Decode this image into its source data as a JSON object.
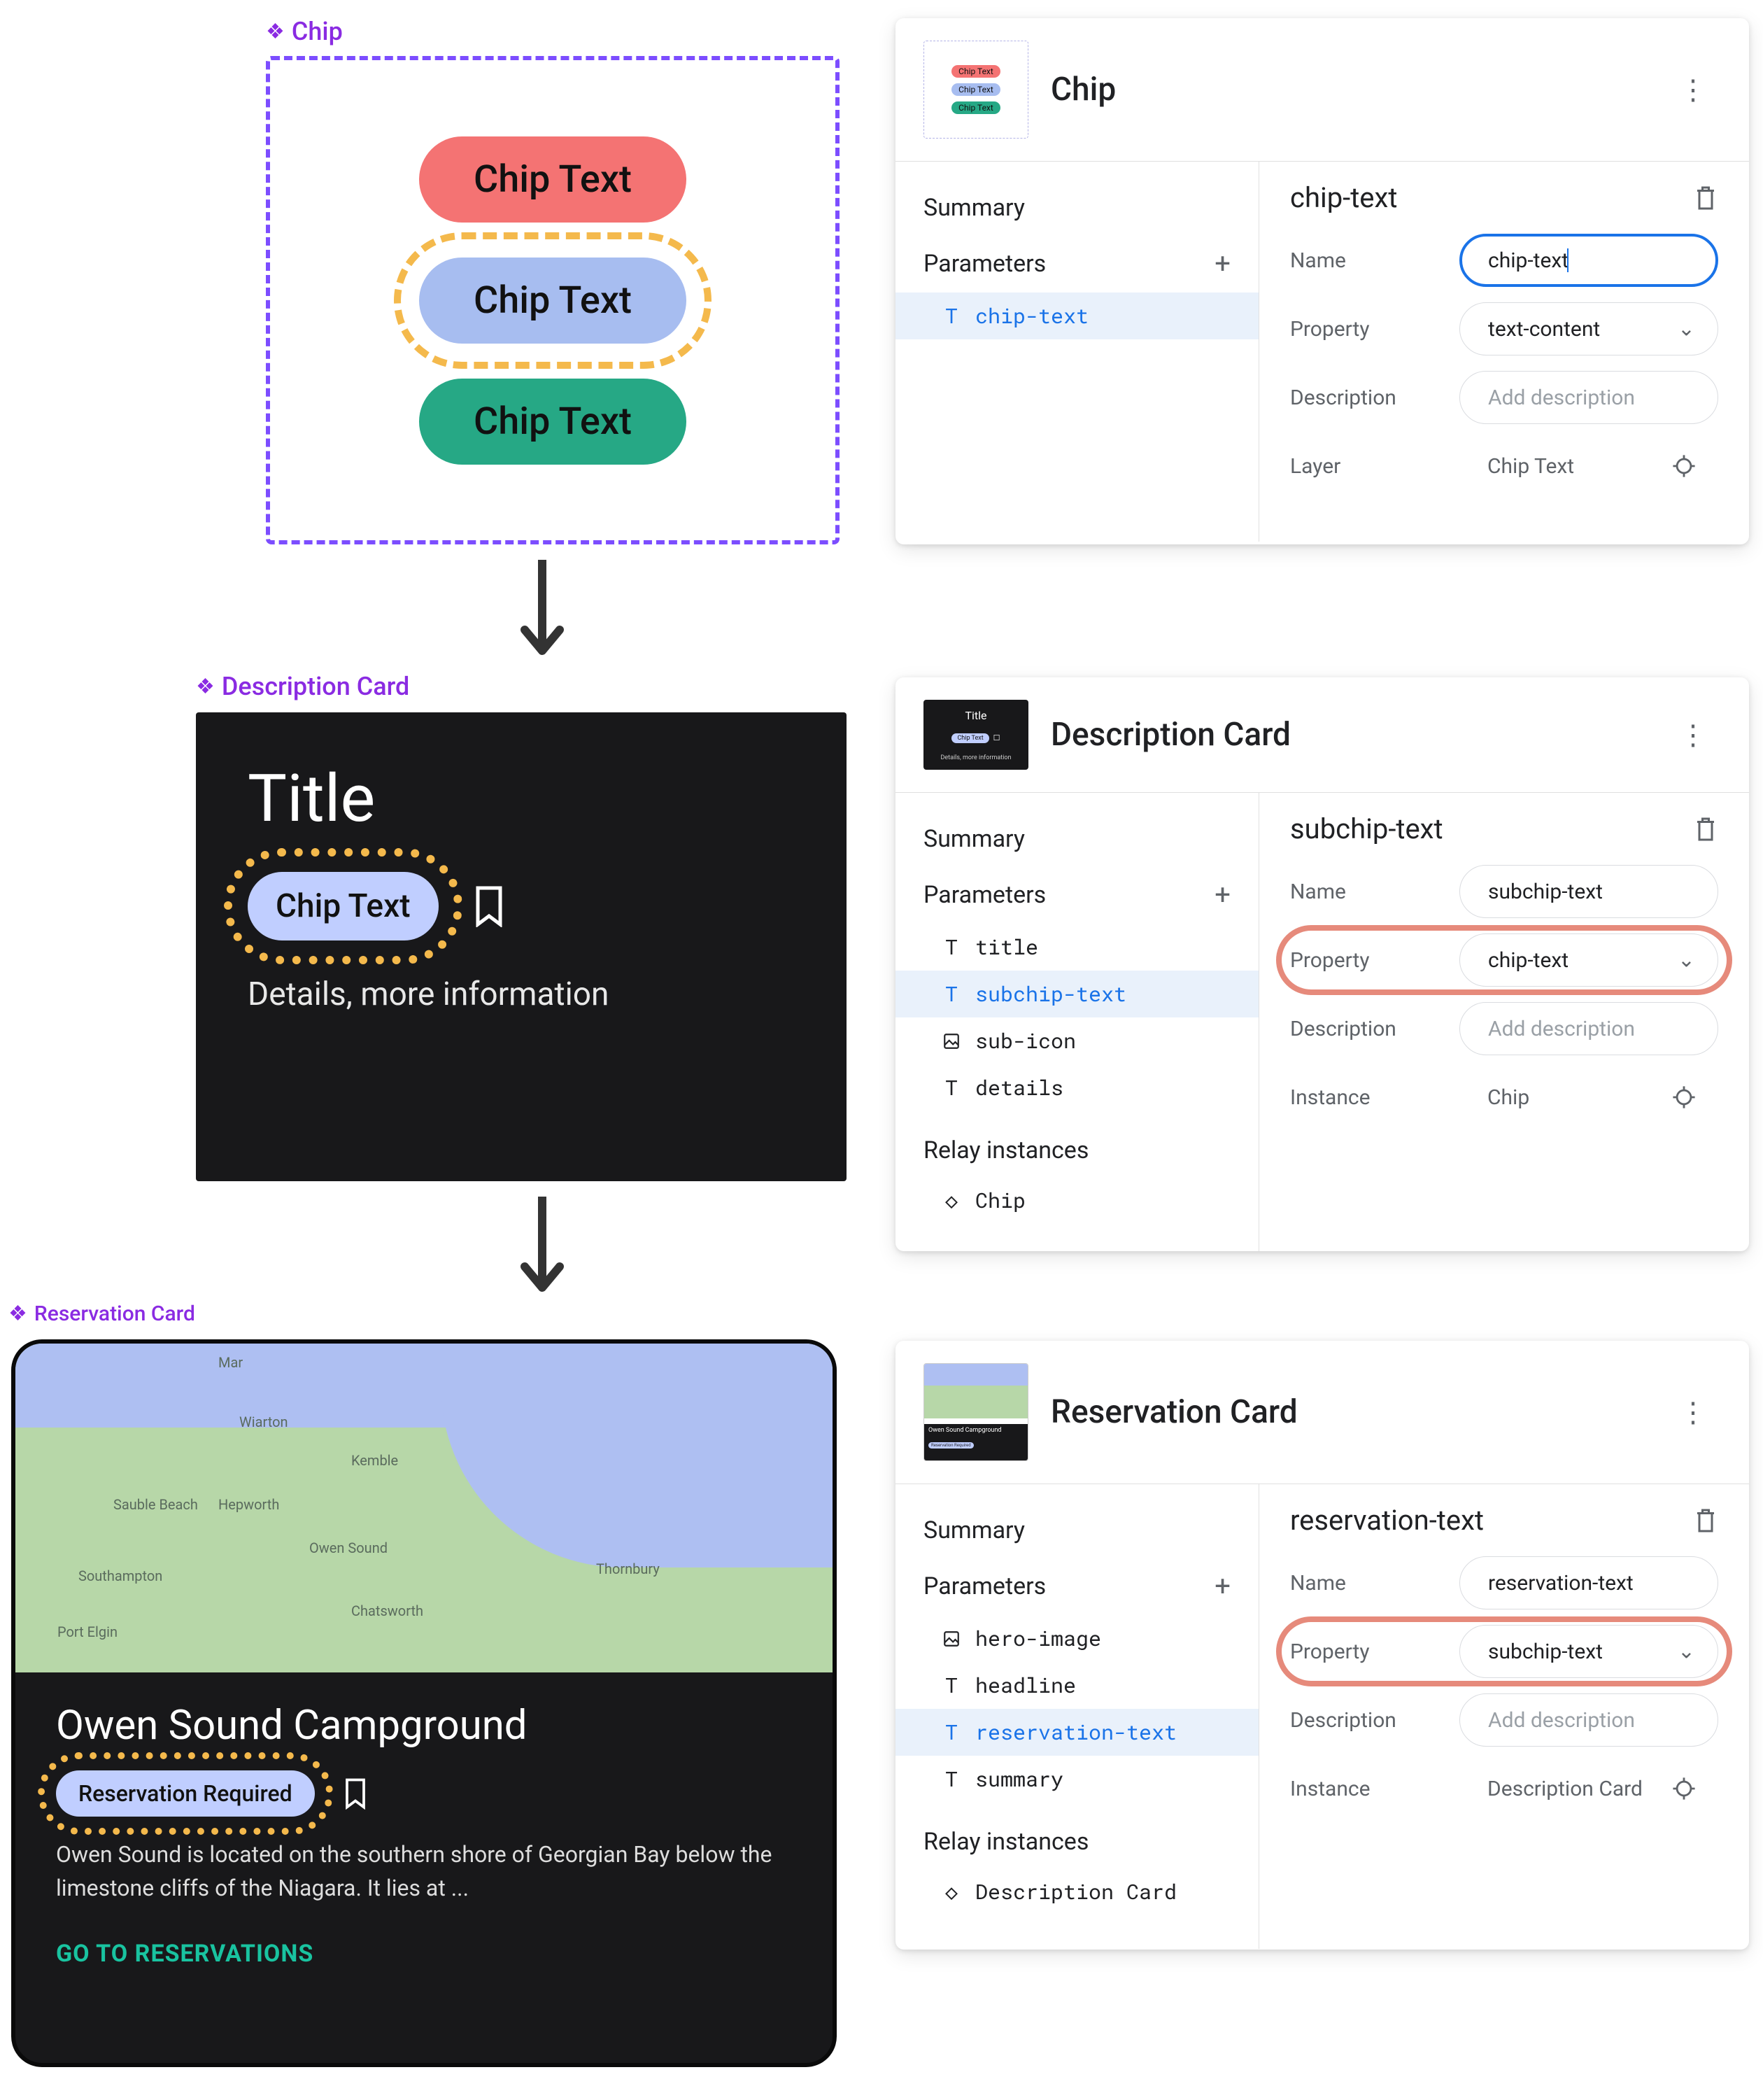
{
  "components": {
    "chip": {
      "label": "Chip",
      "variants": [
        "Chip Text",
        "Chip Text",
        "Chip Text"
      ]
    },
    "description_card": {
      "label": "Description Card",
      "title": "Title",
      "chip_text": "Chip Text",
      "details": "Details, more information"
    },
    "reservation_card": {
      "label": "Reservation Card",
      "headline": "Owen Sound Campground",
      "chip_text": "Reservation Required",
      "summary": "Owen Sound is located on the southern shore of Georgian Bay below the limestone cliffs of the Niagara. It lies at ...",
      "cta": "GO TO RESERVATIONS",
      "map_labels": [
        "Mar",
        "Wiarton",
        "Kemble",
        "Sauble Beach",
        "Hepworth",
        "Owen Sound",
        "Southampton",
        "Chatsworth",
        "Thornbury",
        "Port Elgin"
      ]
    }
  },
  "panels": {
    "chip": {
      "title": "Chip",
      "summary_label": "Summary",
      "parameters_label": "Parameters",
      "params": [
        "chip-text"
      ],
      "form": {
        "title": "chip-text",
        "name_label": "Name",
        "name_value": "chip-text",
        "property_label": "Property",
        "property_value": "text-content",
        "description_label": "Description",
        "description_placeholder": "Add description",
        "layer_label": "Layer",
        "layer_value": "Chip Text"
      }
    },
    "desc": {
      "title": "Description Card",
      "summary_label": "Summary",
      "parameters_label": "Parameters",
      "params": [
        "title",
        "subchip-text",
        "sub-icon",
        "details"
      ],
      "relay_label": "Relay instances",
      "relay_items": [
        "Chip"
      ],
      "form": {
        "title": "subchip-text",
        "name_label": "Name",
        "name_value": "subchip-text",
        "property_label": "Property",
        "property_value": "chip-text",
        "description_label": "Description",
        "description_placeholder": "Add description",
        "instance_label": "Instance",
        "instance_value": "Chip"
      }
    },
    "res": {
      "title": "Reservation Card",
      "summary_label": "Summary",
      "parameters_label": "Parameters",
      "params": [
        "hero-image",
        "headline",
        "reservation-text",
        "summary"
      ],
      "relay_label": "Relay instances",
      "relay_items": [
        "Description Card"
      ],
      "form": {
        "title": "reservation-text",
        "name_label": "Name",
        "name_value": "reservation-text",
        "property_label": "Property",
        "property_value": "subchip-text",
        "description_label": "Description",
        "description_placeholder": "Add description",
        "instance_label": "Instance",
        "instance_value": "Description Card"
      }
    }
  }
}
